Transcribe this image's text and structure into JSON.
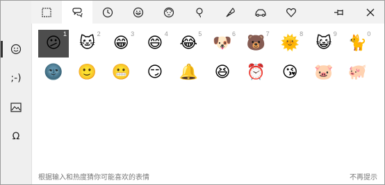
{
  "sidebar": {
    "items": [
      {
        "name": "sidebar-item-emoji",
        "label": "☺",
        "active": true
      },
      {
        "name": "sidebar-item-kaomoji",
        "label": ";-)"
      },
      {
        "name": "sidebar-item-gif",
        "label": ""
      },
      {
        "name": "sidebar-item-symbols",
        "label": "Ω"
      }
    ]
  },
  "tabs": [
    {
      "name": "tab-recent-square",
      "icon": "square-dotted-icon"
    },
    {
      "name": "tab-people",
      "icon": "speech-bubble-icon",
      "active": true
    },
    {
      "name": "tab-clock",
      "icon": "clock-icon"
    },
    {
      "name": "tab-smiley",
      "icon": "smiley-icon"
    },
    {
      "name": "tab-person",
      "icon": "person-icon"
    },
    {
      "name": "tab-balloon",
      "icon": "balloon-icon"
    },
    {
      "name": "tab-pizza",
      "icon": "pizza-icon"
    },
    {
      "name": "tab-car",
      "icon": "car-icon"
    },
    {
      "name": "tab-heart",
      "icon": "heart-icon"
    }
  ],
  "pin_icon": "pin-icon",
  "close_icon": "close-icon",
  "emojis_row1": [
    {
      "name": "confused-face-emoji",
      "char": "😕",
      "num": "1",
      "selected": true
    },
    {
      "name": "cat-face-emoji",
      "char": "🐱",
      "num": "2"
    },
    {
      "name": "grinning-teeth-emoji",
      "char": "😁",
      "num": "3"
    },
    {
      "name": "grinning-face-emoji",
      "char": "😄",
      "num": "4"
    },
    {
      "name": "tears-of-joy-emoji",
      "char": "😂",
      "num": "5"
    },
    {
      "name": "dog-face-emoji",
      "char": "🐶",
      "num": "6"
    },
    {
      "name": "bear-face-emoji",
      "char": "🐻",
      "num": "7"
    },
    {
      "name": "sun-face-emoji",
      "char": "🌞",
      "num": "8"
    },
    {
      "name": "smiling-cat-emoji",
      "char": "😺",
      "num": "9"
    },
    {
      "name": "cat-emoji",
      "char": "🐈",
      "num": "0"
    }
  ],
  "emojis_row2": [
    {
      "name": "new-moon-face-emoji",
      "char": "🌚"
    },
    {
      "name": "smiling-face-emoji",
      "char": "🙂"
    },
    {
      "name": "grimacing-face-emoji",
      "char": "😬"
    },
    {
      "name": "smirking-face-emoji",
      "char": "😏"
    },
    {
      "name": "bell-emoji",
      "char": "🔔"
    },
    {
      "name": "squinting-face-emoji",
      "char": "😆"
    },
    {
      "name": "alarm-clock-emoji",
      "char": "⏰"
    },
    {
      "name": "kissing-face-emoji",
      "char": "😘"
    },
    {
      "name": "pig-face-emoji",
      "char": "🐷"
    },
    {
      "name": "pig-emoji",
      "char": "🐖"
    }
  ],
  "footer": {
    "hint": "根据输入和热度猜你可能喜欢的表情",
    "dismiss": "不再提示"
  }
}
